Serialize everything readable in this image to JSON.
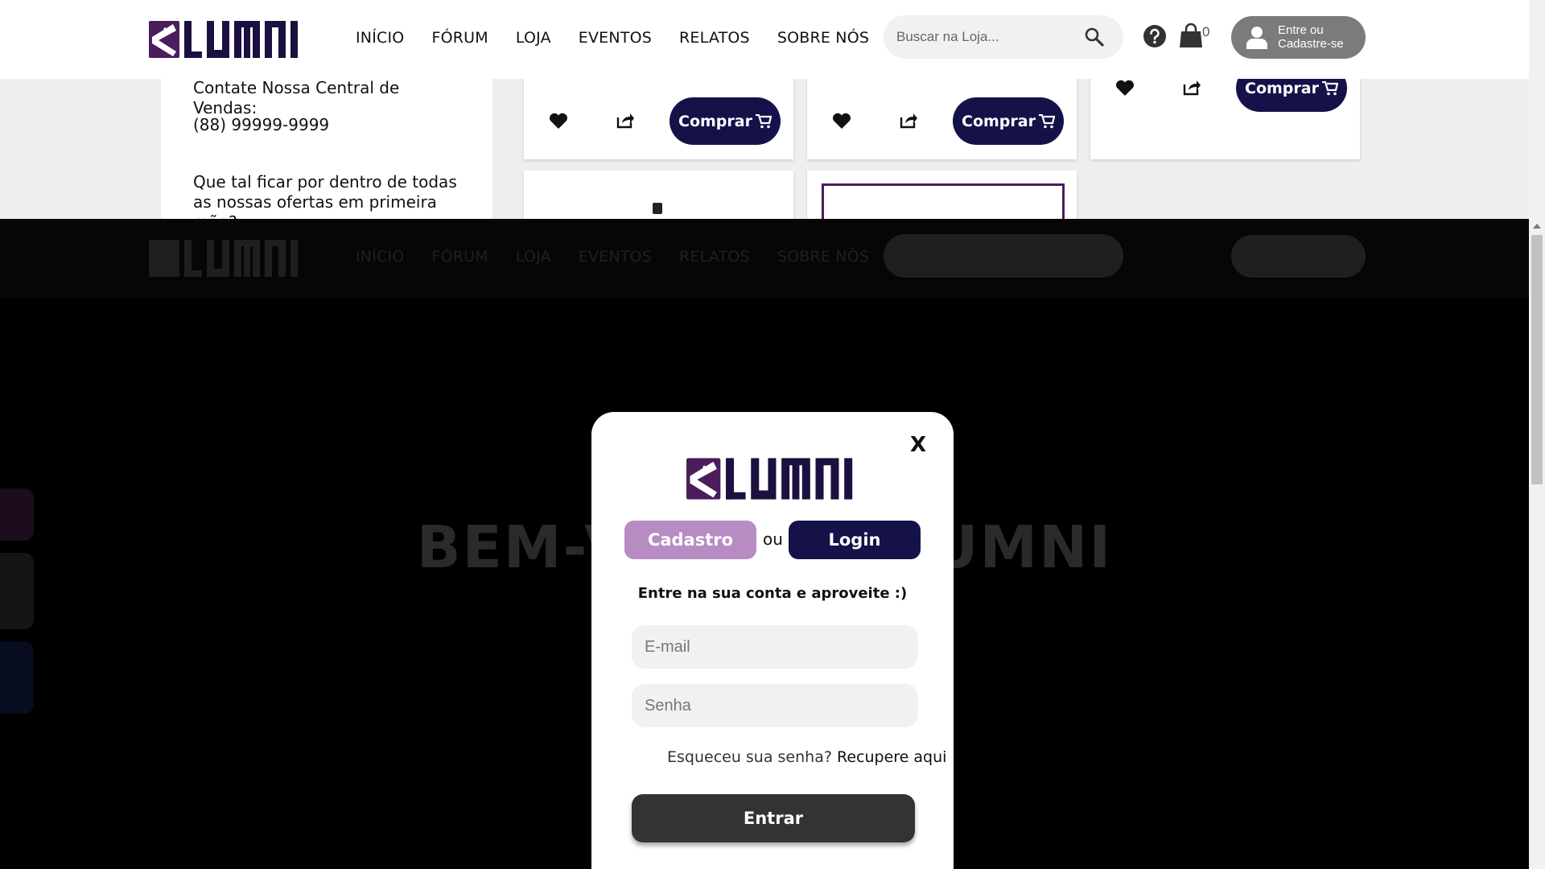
{
  "header": {
    "nav": [
      "INÍCIO",
      "FÓRUM",
      "LOJA",
      "EVENTOS",
      "RELATOS",
      "SOBRE NÓS"
    ],
    "search_placeholder": "Buscar na Loja...",
    "cart_count": "0",
    "login_line1": "Entre ou",
    "login_line2": "Cadastre-se"
  },
  "sidebar": {
    "contact_label": "Contate Nossa Central de Vendas:",
    "phone": "(88) 99999-9999",
    "offer_text": "Que tal ficar por dentro de todas as nossas ofertas em primeira mão?"
  },
  "products": {
    "buy_label": "Comprar"
  },
  "hero": {
    "title": "BEM-VINDO À LUMNI"
  },
  "modal": {
    "close_label": "X",
    "tab_signup": "Cadastro",
    "tab_or": "ou",
    "tab_login": "Login",
    "subtitle": "Entre na sua conta e aproveite :)",
    "email_placeholder": "E-mail",
    "password_placeholder": "Senha",
    "forgot_text": "Esqueceu sua senha?",
    "forgot_link": "Recupere aqui",
    "submit_label": "Entrar"
  },
  "colors": {
    "brand_navy": "#15124a",
    "brand_purple": "#4a1d5c",
    "tab_lilac": "#b68cc3",
    "submit_dark": "#333333"
  },
  "icons": [
    "lumni-logo",
    "search-icon",
    "help-icon",
    "shopping-bag-icon",
    "user-icon",
    "heart-icon",
    "share-icon",
    "cart-icon"
  ]
}
